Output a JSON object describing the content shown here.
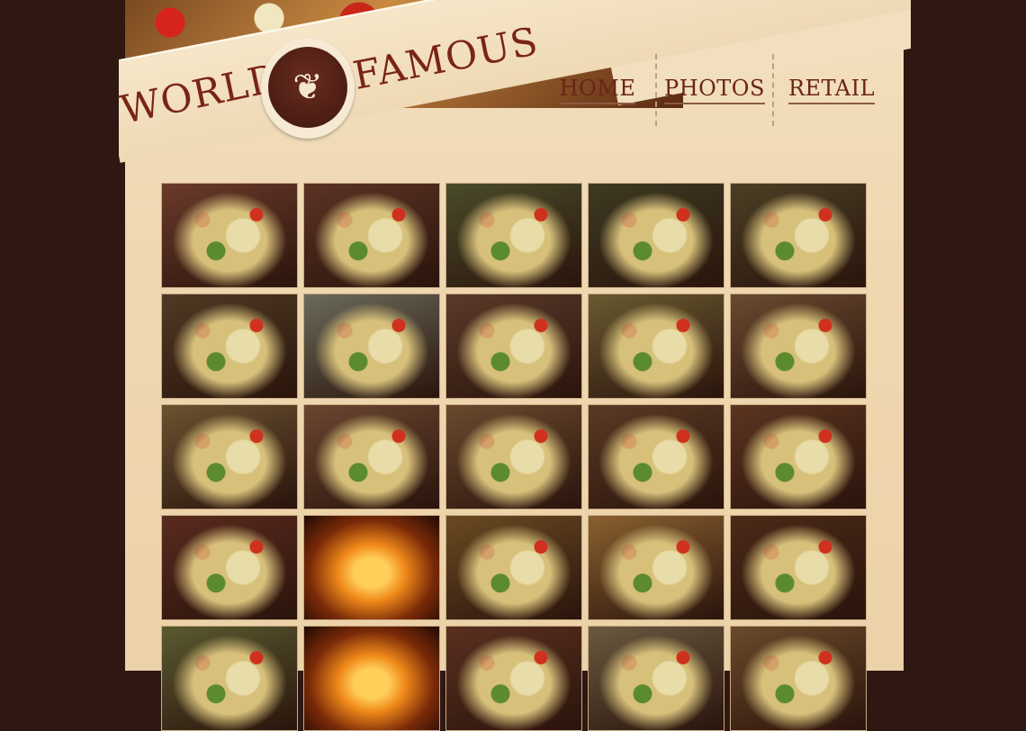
{
  "header": {
    "logo_words": [
      "WORLD",
      "FAMOUS"
    ],
    "logo_glyph": "❦"
  },
  "nav": {
    "items": [
      {
        "label": "HOME"
      },
      {
        "label": "PHOTOS"
      },
      {
        "label": "RETAIL"
      }
    ]
  },
  "gallery": {
    "photos": [
      {
        "subject": "pizza-square-purple-onion",
        "tone": "#6b3a2a"
      },
      {
        "subject": "pizza-square-dark",
        "tone": "#5b3324"
      },
      {
        "subject": "pizza-green-on-board",
        "tone": "#4a4b2a"
      },
      {
        "subject": "pizza-green-dark-board",
        "tone": "#3d3a22"
      },
      {
        "subject": "pizza-green-closeup",
        "tone": "#4a3f25"
      },
      {
        "subject": "pizza-green-red-board",
        "tone": "#4f3a24"
      },
      {
        "subject": "hand-holding-slice",
        "tone": "#6b6b5a"
      },
      {
        "subject": "pizza-green-angle",
        "tone": "#5a3a2a"
      },
      {
        "subject": "pizza-cheese-green",
        "tone": "#6a5a30"
      },
      {
        "subject": "pizza-red-pepper",
        "tone": "#6a4a30"
      },
      {
        "subject": "pizza-red-green-square",
        "tone": "#6a5230"
      },
      {
        "subject": "pizza-red-green-closeup",
        "tone": "#6a4630"
      },
      {
        "subject": "pizza-red-green-edge",
        "tone": "#6a4a2e"
      },
      {
        "subject": "pizza-meat-peppers",
        "tone": "#5a3a24"
      },
      {
        "subject": "pizza-salami-closeup",
        "tone": "#5b3420"
      },
      {
        "subject": "pizza-restaurant-table",
        "tone": "#5a2a1e"
      },
      {
        "subject": "wood-oven-fire",
        "tone": "#7a3a10"
      },
      {
        "subject": "pizza-cheese-glowing",
        "tone": "#6a4a22"
      },
      {
        "subject": "pizza-dessert-crust",
        "tone": "#8a6030"
      },
      {
        "subject": "pizza-dessert-dark",
        "tone": "#4a2a18"
      },
      {
        "subject": "pizza-green-bottom",
        "tone": "#5a5a30"
      },
      {
        "subject": "wood-oven-flames",
        "tone": "#7a3a10"
      },
      {
        "subject": "pizza-red-partial",
        "tone": "#5a3020"
      },
      {
        "subject": "pizza-on-white-board",
        "tone": "#6a5a40"
      },
      {
        "subject": "pizza-lattice-dessert",
        "tone": "#6a4a2a"
      }
    ]
  }
}
